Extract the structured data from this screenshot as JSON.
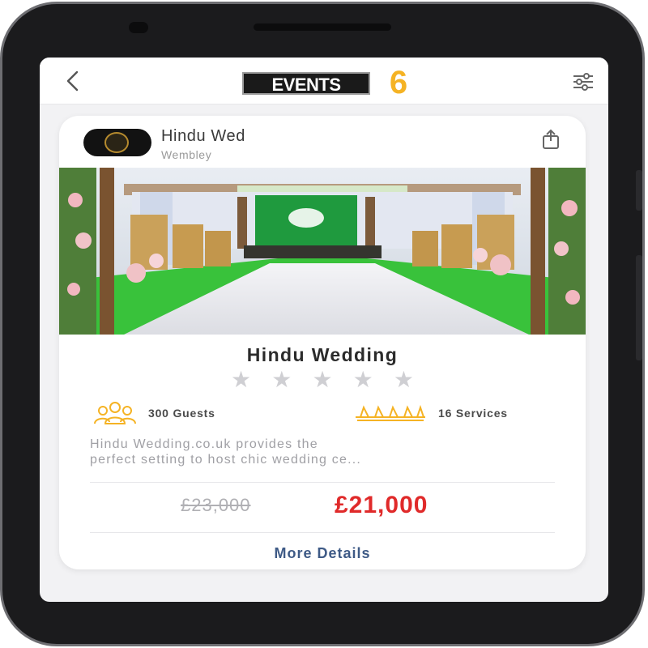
{
  "header": {
    "back_icon": "chevron-left-icon",
    "logo_text": "EVENTS",
    "logo_number": "6",
    "filter_icon": "sliders-icon"
  },
  "venue": {
    "name": "Hindu Wed",
    "location": "Wembley",
    "share_icon": "share-icon"
  },
  "listing": {
    "title": "Hindu Wedding",
    "rating": 0,
    "rating_max": 5,
    "guests": "300 Guests",
    "services": "16 Services",
    "description": "Hindu Wedding.co.uk provides the\nperfect setting to host chic wedding ce...",
    "old_price": "£23,000",
    "price": "£21,000",
    "more_label": "More Details"
  },
  "colors": {
    "accent_gold": "#f5b324",
    "price_red": "#e02a2a",
    "link_blue": "#3e5a86"
  }
}
